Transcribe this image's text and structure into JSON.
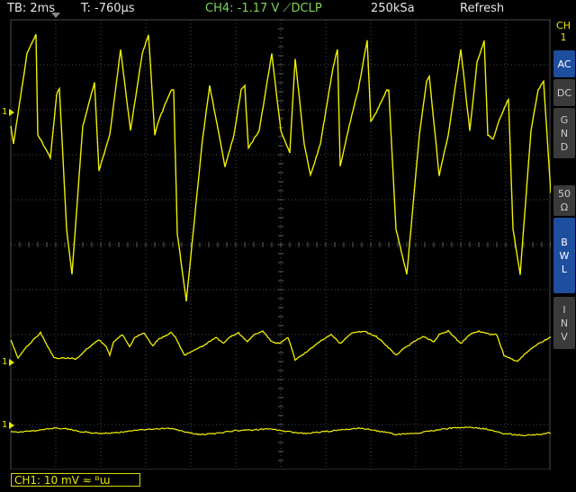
{
  "topbar": {
    "timebase": "TB: 2ms",
    "trigger_time": "T: -760µs",
    "trigger_info": "CH4: -1.17 V ⟋DCLP",
    "sample_rate": "250kSa",
    "acq_mode": "Refresh"
  },
  "side_panel": {
    "channel_label": "CH\n1",
    "buttons": [
      {
        "label": "AC",
        "active": true
      },
      {
        "label": "DC",
        "active": false
      },
      {
        "label": "G\nN\nD",
        "active": false
      },
      {
        "label": "50\nΩ",
        "active": false
      },
      {
        "label": "B\nW\nL",
        "active": true
      },
      {
        "label": "I\nN\nV",
        "active": false
      }
    ]
  },
  "channel_bar": {
    "text": "CH1: 10 mV ≈ ᴮɯ"
  },
  "ref_markers": [
    {
      "label": "1"
    },
    {
      "label": "1"
    },
    {
      "label": "1"
    }
  ],
  "colors": {
    "trace": "#f0f000",
    "ch4": "#7fd55a",
    "grid": "#555555",
    "active_button": "#1e4e9e"
  }
}
